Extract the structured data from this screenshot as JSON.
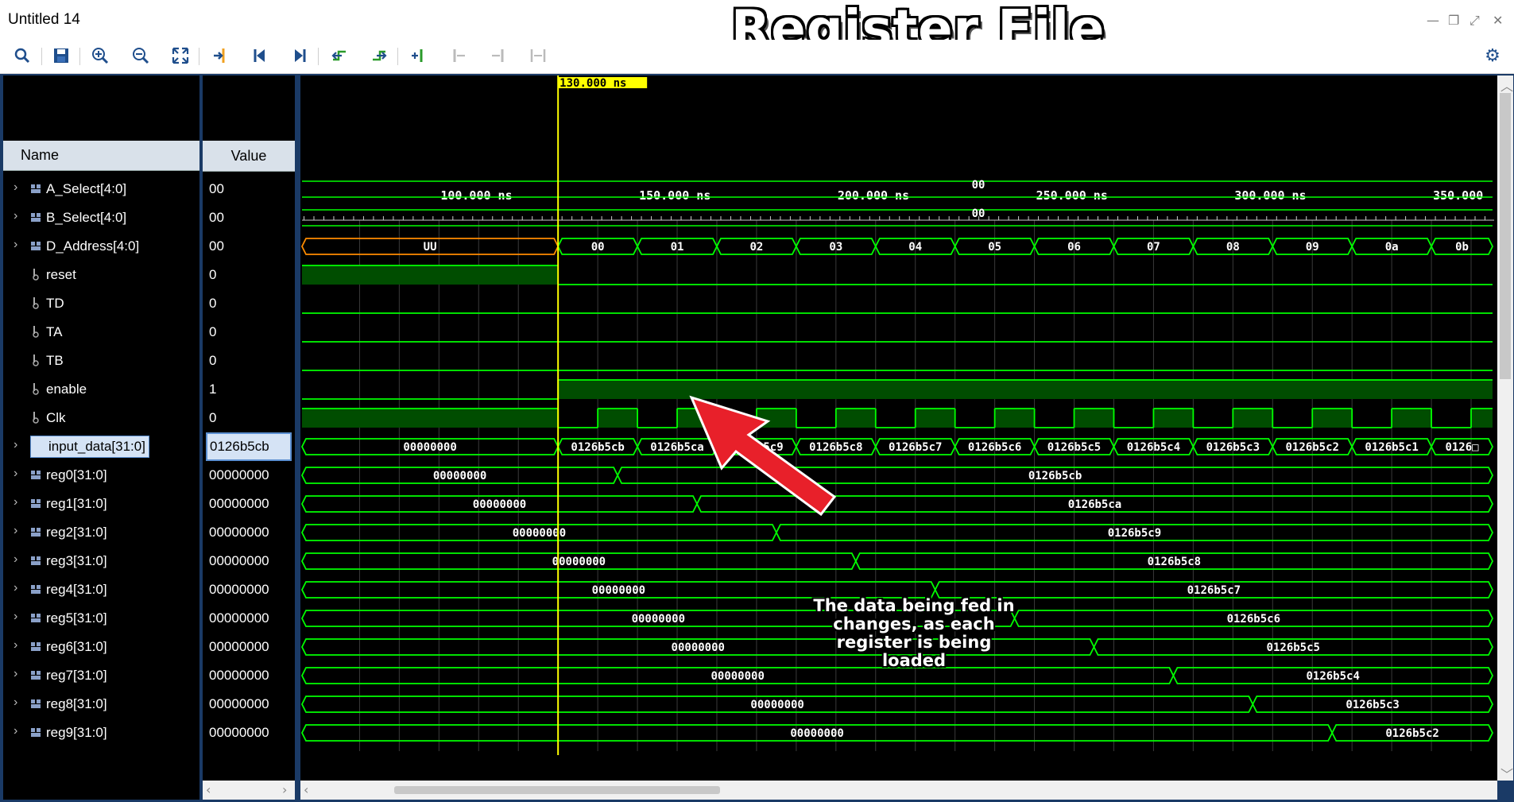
{
  "window": {
    "title": "Untitled 14",
    "overlay_title": "Register File",
    "controls": [
      "—",
      "❐",
      "⤢",
      "✕"
    ]
  },
  "toolbar": {
    "buttons": [
      {
        "name": "search-icon",
        "glyph": "⌕"
      },
      {
        "name": "save-icon",
        "glyph": "💾"
      },
      {
        "name": "zoom-in-icon",
        "glyph": "⊕"
      },
      {
        "name": "zoom-out-icon",
        "glyph": "⊖"
      },
      {
        "name": "zoom-fit-icon",
        "glyph": "⤧"
      },
      {
        "name": "go-to-cursor-icon",
        "glyph": "→|"
      },
      {
        "name": "go-to-start-icon",
        "glyph": "|◀"
      },
      {
        "name": "go-to-end-icon",
        "glyph": "▶|"
      },
      {
        "name": "previous-transition-icon",
        "glyph": "⇤"
      },
      {
        "name": "next-transition-icon",
        "glyph": "⇥"
      },
      {
        "name": "add-marker-icon",
        "glyph": "+|"
      },
      {
        "name": "previous-marker-icon",
        "glyph": "|◂"
      },
      {
        "name": "next-marker-icon",
        "glyph": "▸|"
      },
      {
        "name": "swap-cursors-icon",
        "glyph": "|↔|"
      }
    ],
    "settings_icon": "⚙"
  },
  "panel": {
    "name_header": "Name",
    "value_header": "Value"
  },
  "signals": [
    {
      "name": "A_Select[4:0]",
      "value": "00",
      "bus": true
    },
    {
      "name": "B_Select[4:0]",
      "value": "00",
      "bus": true
    },
    {
      "name": "D_Address[4:0]",
      "value": "00",
      "bus": true
    },
    {
      "name": "reset",
      "value": "0",
      "bus": false
    },
    {
      "name": "TD",
      "value": "0",
      "bus": false
    },
    {
      "name": "TA",
      "value": "0",
      "bus": false
    },
    {
      "name": "TB",
      "value": "0",
      "bus": false
    },
    {
      "name": "enable",
      "value": "1",
      "bus": false
    },
    {
      "name": "Clk",
      "value": "0",
      "bus": false
    },
    {
      "name": "input_data[31:0]",
      "value": "0126b5cb",
      "bus": true,
      "selected": true
    },
    {
      "name": "reg0[31:0]",
      "value": "00000000",
      "bus": true
    },
    {
      "name": "reg1[31:0]",
      "value": "00000000",
      "bus": true
    },
    {
      "name": "reg2[31:0]",
      "value": "00000000",
      "bus": true
    },
    {
      "name": "reg3[31:0]",
      "value": "00000000",
      "bus": true
    },
    {
      "name": "reg4[31:0]",
      "value": "00000000",
      "bus": true
    },
    {
      "name": "reg5[31:0]",
      "value": "00000000",
      "bus": true
    },
    {
      "name": "reg6[31:0]",
      "value": "00000000",
      "bus": true
    },
    {
      "name": "reg7[31:0]",
      "value": "00000000",
      "bus": true
    },
    {
      "name": "reg8[31:0]",
      "value": "00000000",
      "bus": true
    },
    {
      "name": "reg9[31:0]",
      "value": "00000000",
      "bus": true
    }
  ],
  "timeline": {
    "cursor_label": "130.000 ns",
    "cursor_ns": 130,
    "tick_labels": [
      "100.000 ns",
      "150.000 ns",
      "200.000 ns",
      "250.000 ns",
      "300.000 ns",
      "350.000"
    ],
    "tick_ns": [
      100,
      150,
      200,
      250,
      300,
      350
    ],
    "t_start_ns": 65.5,
    "t_end_ns": 365
  },
  "waveforms": {
    "A_Select": "00",
    "B_Select": "00",
    "D_Address": {
      "initial": "UU",
      "values": [
        "00",
        "01",
        "02",
        "03",
        "04",
        "05",
        "06",
        "07",
        "08",
        "09",
        "0a",
        "0b"
      ]
    },
    "input_data": {
      "initial": "00000000",
      "values": [
        "0126b5cb",
        "0126b5ca",
        "0126b5c9",
        "0126b5c8",
        "0126b5c7",
        "0126b5c6",
        "0126b5c5",
        "0126b5c4",
        "0126b5c3",
        "0126b5c2",
        "0126b5c1",
        "0126□"
      ]
    },
    "registers": [
      {
        "reg": "reg0",
        "before": "00000000",
        "after": "0126b5cb"
      },
      {
        "reg": "reg1",
        "before": "00000000",
        "after": "0126b5ca"
      },
      {
        "reg": "reg2",
        "before": "00000000",
        "after": "0126b5c9"
      },
      {
        "reg": "reg3",
        "before": "00000000",
        "after": "0126b5c8"
      },
      {
        "reg": "reg4",
        "before": "00000000",
        "after": "0126b5c7"
      },
      {
        "reg": "reg5",
        "before": "00000000",
        "after": "0126b5c6"
      },
      {
        "reg": "reg6",
        "before": "00000000",
        "after": "0126b5c5"
      },
      {
        "reg": "reg7",
        "before": "00000000",
        "after": "0126b5c4"
      },
      {
        "reg": "reg8",
        "before": "00000000",
        "after": "0126b5c3"
      },
      {
        "reg": "reg9",
        "before": "00000000",
        "after": "0126b5c2"
      }
    ]
  },
  "annotation": {
    "text": "The data being fed in changes, as each register is being loaded"
  },
  "colors": {
    "wave": "#00ff00",
    "bus_fill": "#004d00",
    "cursor": "#ffff00",
    "undefined": "#ff8c00",
    "arrow": "#e8202a"
  }
}
